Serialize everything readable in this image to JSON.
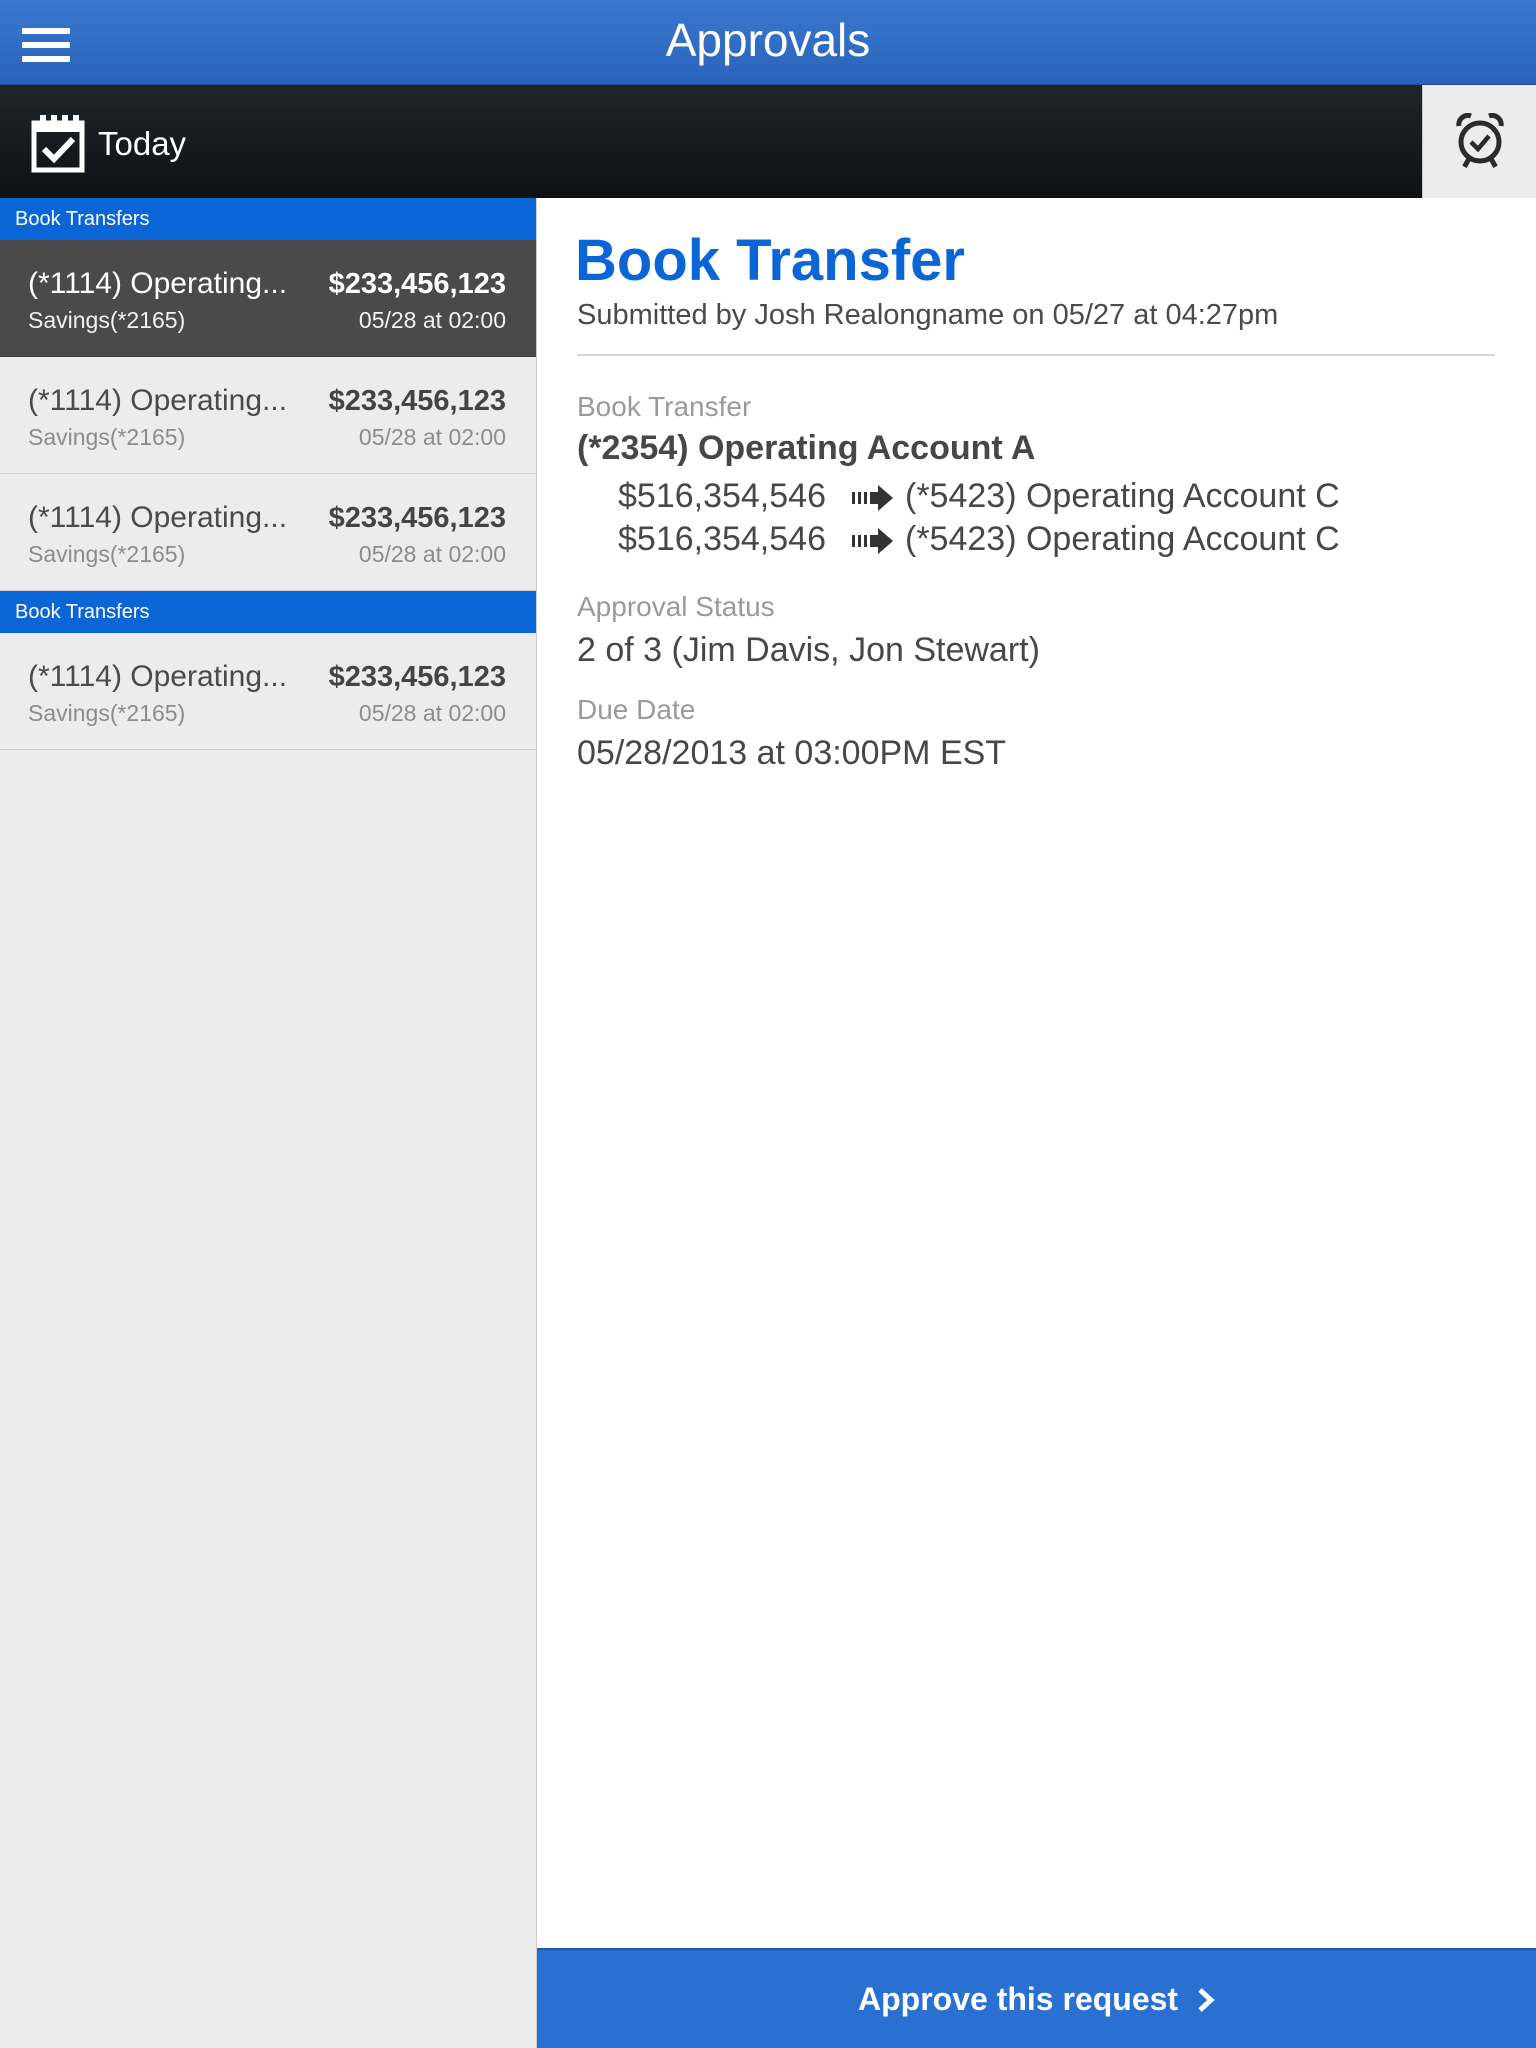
{
  "header": {
    "title": "Approvals"
  },
  "datebar": {
    "label": "Today"
  },
  "list": {
    "sections": [
      {
        "header": "Book Transfers",
        "items": [
          {
            "title": "(*1114) Operating...",
            "subtitle": "Savings(*2165)",
            "amount": "$233,456,123",
            "date": "05/28 at 02:00",
            "selected": true
          },
          {
            "title": "(*1114) Operating...",
            "subtitle": "Savings(*2165)",
            "amount": "$233,456,123",
            "date": "05/28 at 02:00",
            "selected": false
          },
          {
            "title": "(*1114) Operating...",
            "subtitle": "Savings(*2165)",
            "amount": "$233,456,123",
            "date": "05/28 at 02:00",
            "selected": false
          }
        ]
      },
      {
        "header": "Book Transfers",
        "items": [
          {
            "title": "(*1114) Operating...",
            "subtitle": "Savings(*2165)",
            "amount": "$233,456,123",
            "date": "05/28 at 02:00",
            "selected": false
          }
        ]
      }
    ]
  },
  "detail": {
    "title": "Book Transfer",
    "submitted": "Submitted by Josh Realongname on 05/27 at 04:27pm",
    "type_label": "Book Transfer",
    "source_account": "(*2354) Operating Account A",
    "transfers": [
      {
        "amount": "$516,354,546",
        "destination": "(*5423) Operating Account C"
      },
      {
        "amount": "$516,354,546",
        "destination": "(*5423) Operating Account C"
      }
    ],
    "status_label": "Approval Status",
    "status_value": "2 of 3 (Jim Davis, Jon Stewart)",
    "due_label": "Due Date",
    "due_value": "05/28/2013 at 03:00PM EST"
  },
  "actions": {
    "approve_label": "Approve this request"
  },
  "colors": {
    "accent": "#0a66d6",
    "topbar": "#2f6cc6",
    "datebar": "#14181c",
    "selected_row": "#4a4a4a",
    "list_bg": "#ececec",
    "approve_button": "#2a6fd2"
  },
  "icons": {
    "menu": "hamburger-menu-icon",
    "calendar": "calendar-check-icon",
    "alarm": "alarm-clock-icon",
    "transfer_arrow": "arrow-right-icon",
    "chevron": "chevron-right-icon"
  }
}
